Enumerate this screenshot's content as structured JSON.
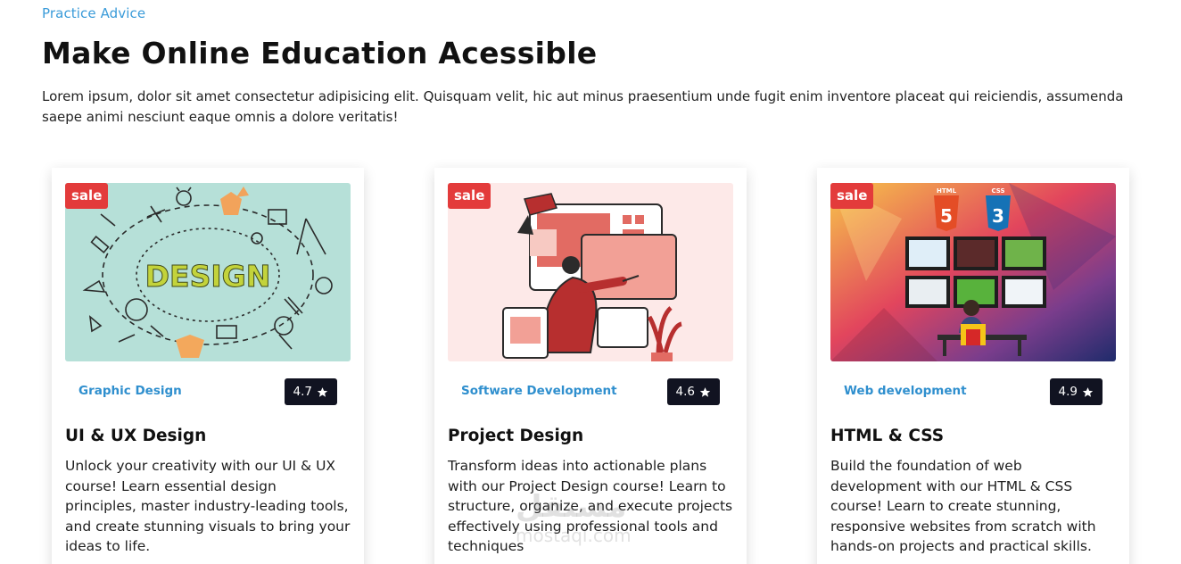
{
  "header": {
    "eyebrow": "Practice Advice",
    "title": "Make Online Education Acessible",
    "description": "Lorem ipsum, dolor sit amet consectetur adipisicing elit. Quisquam velit, hic aut minus praesentium unde fugit enim inventore placeat qui reiciendis, assumenda saepe animi nesciunt eaque omnis a dolore veritatis!"
  },
  "courses": [
    {
      "badge": "sale",
      "category": "Graphic Design",
      "rating": "4.7",
      "title": "UI & UX Design",
      "description": "Unlock your creativity with our UI & UX course! Learn essential design principles, master industry-leading tools, and create stunning visuals to bring your ideas to life.",
      "image_word": "DESIGN"
    },
    {
      "badge": "sale",
      "category": "Software Development",
      "rating": "4.6",
      "title": "Project Design",
      "description": "Transform ideas into actionable plans with our Project Design course! Learn to structure, organize, and execute projects effectively using professional tools and techniques"
    },
    {
      "badge": "sale",
      "category": "Web development",
      "rating": "4.9",
      "title": "HTML & CSS",
      "description": "Build the foundation of web development with our HTML & CSS course! Learn to create stunning, responsive websites from scratch with hands-on projects and practical skills.",
      "image_labels": [
        "HTML",
        "CSS"
      ]
    }
  ],
  "colors": {
    "accent": "#3a9bd9",
    "sale": "#e33b3b",
    "rating_bg": "#111321"
  },
  "icons": {
    "rating": "star-icon"
  },
  "watermark": {
    "text": "مستقل",
    "sub": "mostaql.com"
  }
}
